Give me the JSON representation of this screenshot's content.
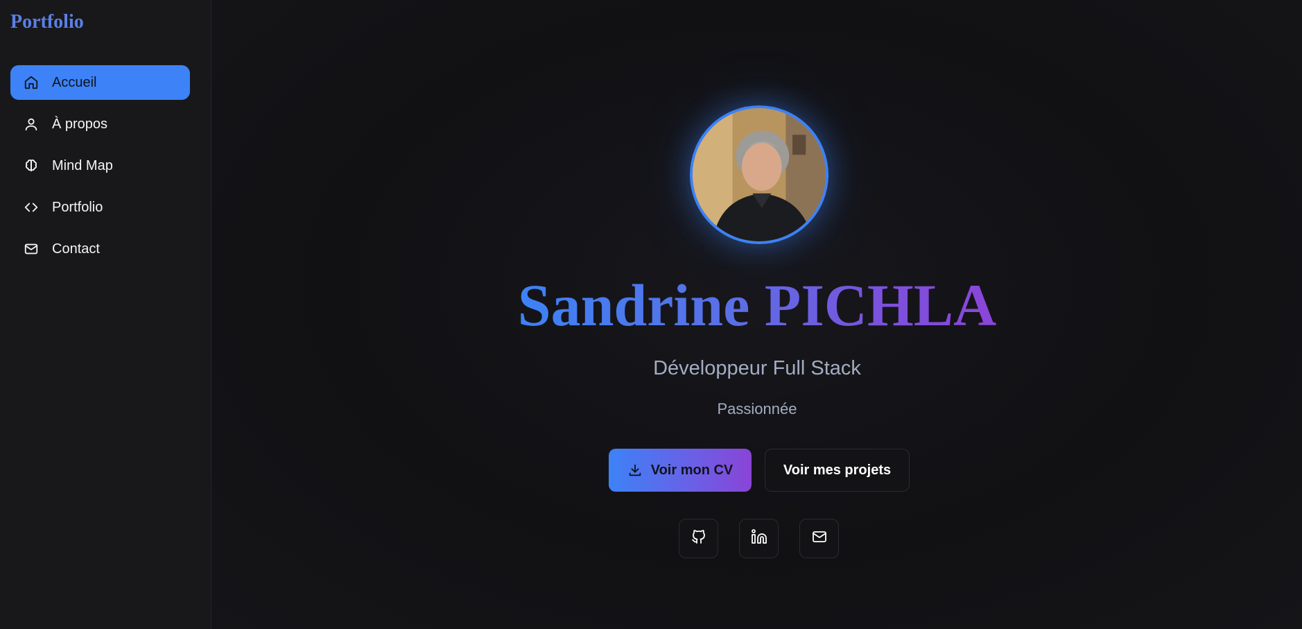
{
  "sidebar": {
    "brand": "Portfolio",
    "items": [
      {
        "label": "Accueil",
        "icon": "home-icon",
        "active": true
      },
      {
        "label": "À propos",
        "icon": "user-icon",
        "active": false
      },
      {
        "label": "Mind Map",
        "icon": "brain-icon",
        "active": false
      },
      {
        "label": "Portfolio",
        "icon": "code-icon",
        "active": false
      },
      {
        "label": "Contact",
        "icon": "mail-icon",
        "active": false
      }
    ]
  },
  "hero": {
    "name": "Sandrine PICHLA",
    "subtitle": "Développeur Full Stack",
    "tagline": "Passionnée",
    "cv_button": "Voir mon CV",
    "projects_button": "Voir mes projets",
    "social": [
      "github-icon",
      "linkedin-icon",
      "mail-icon"
    ]
  },
  "colors": {
    "accent": "#3d82f6",
    "gradient_end": "#8b45d8",
    "background": "#121214",
    "sidebar": "#18181b"
  }
}
